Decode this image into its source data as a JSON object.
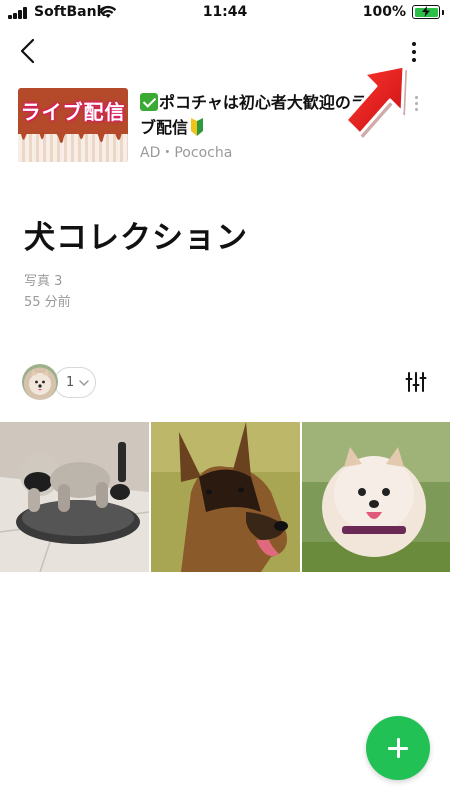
{
  "status_bar": {
    "carrier": "SoftBank",
    "time": "11:44",
    "battery_percent": "100%",
    "battery_level": 1.0,
    "charging": true
  },
  "nav": {
    "back_icon": "chevron-left-icon",
    "more_icon": "vertical-ellipsis-icon"
  },
  "ad": {
    "image_text": "ライブ配信",
    "title": "ポコチャは初心者大歓迎のライブ配信",
    "source": "AD・Pococha",
    "title_prefix_icon": "checkmark-icon",
    "title_suffix_icon": "beginner-mark-icon"
  },
  "album": {
    "title": "犬コレクション",
    "photo_count": "写真 3",
    "updated": "55 分前"
  },
  "members": {
    "count": "1"
  },
  "photos": [
    {
      "subject": "robot dog"
    },
    {
      "subject": "german shepherd"
    },
    {
      "subject": "pomeranian"
    }
  ],
  "colors": {
    "accent_green": "#22c155",
    "annotation_red": "#e8141c",
    "muted_text": "#9a9a9a"
  }
}
